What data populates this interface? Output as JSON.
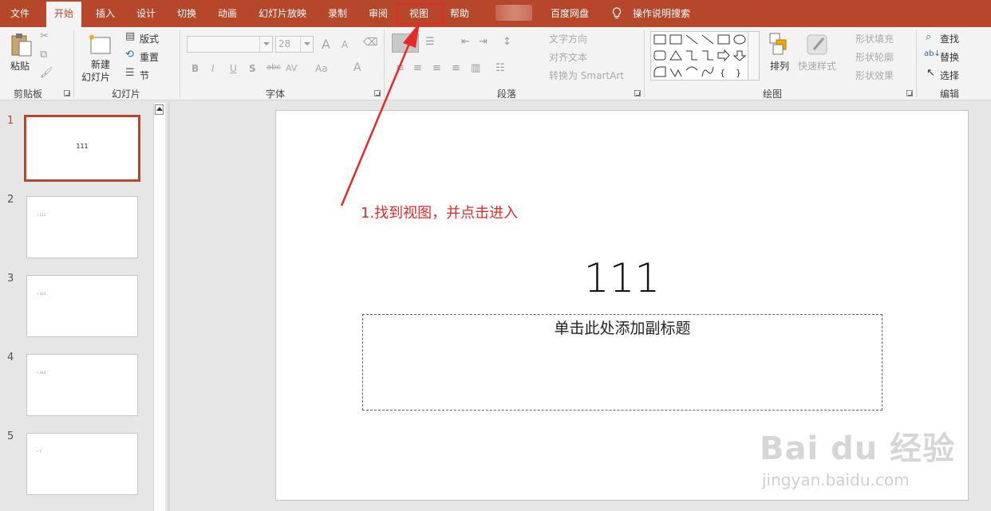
{
  "tabs": [
    "文件",
    "开始",
    "插入",
    "设计",
    "切换",
    "动画",
    "幻灯片放映",
    "录制",
    "审阅",
    "视图",
    "帮助",
    "百度网盘",
    "操作说明搜索"
  ],
  "ribbon": {
    "clipboard": {
      "label": "剪贴板",
      "paste": "粘贴"
    },
    "slides": {
      "label": "幻灯片",
      "new_slide_1": "新建",
      "new_slide_2": "幻灯片",
      "layout": "版式",
      "reset": "重置",
      "section": "节"
    },
    "font": {
      "label": "字体",
      "size": "28",
      "bold": "B",
      "italic": "I",
      "underline": "U",
      "shadow": "S",
      "strike": "abc",
      "spacing": "AV",
      "case": "Aa",
      "color": "A",
      "grow": "A",
      "shrink": "A"
    },
    "paragraph": {
      "label": "段落",
      "text_direction": "文字方向",
      "align_text": "对齐文本",
      "smartart": "转换为 SmartArt"
    },
    "drawing": {
      "label": "绘图",
      "arrange": "排列",
      "quick_styles": "快速样式",
      "fill": "形状填充",
      "outline": "形状轮廓",
      "effects": "形状效果"
    },
    "editing": {
      "label": "编辑",
      "find": "查找",
      "replace": "替换",
      "select": "选择"
    }
  },
  "thumbnails": [
    {
      "num": "1",
      "title": "111"
    },
    {
      "num": "2",
      "text": "• 222"
    },
    {
      "num": "3",
      "text": "• 333"
    },
    {
      "num": "4",
      "text": "• 444"
    },
    {
      "num": "5",
      "text": "• 5"
    }
  ],
  "slide": {
    "title": "111",
    "subtitle_placeholder": "单击此处添加副标题"
  },
  "annotation": {
    "text": "1.找到视图，并点击进入",
    "color": "#e62a2a"
  },
  "watermark": {
    "logo": "Bai du 经验",
    "url": "jingyan.baidu.com"
  },
  "colors": {
    "accent": "#b7472a"
  }
}
